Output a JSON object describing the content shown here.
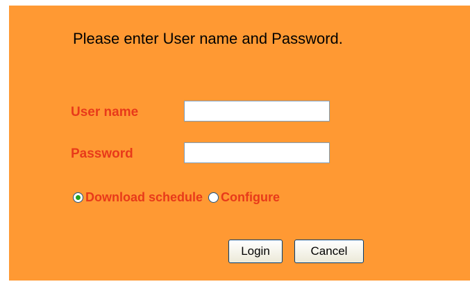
{
  "colors": {
    "panel_background": "#ff9933",
    "label_red": "#e83a1a",
    "title_text": "#000000"
  },
  "form": {
    "title": "Please enter User name and Password.",
    "username_label": "User name",
    "username_value": "",
    "password_label": "Password",
    "password_value": "",
    "mode_options": [
      {
        "label": "Download schedule",
        "selected": true
      },
      {
        "label": "Configure",
        "selected": false
      }
    ],
    "login_label": "Login",
    "cancel_label": "Cancel"
  }
}
